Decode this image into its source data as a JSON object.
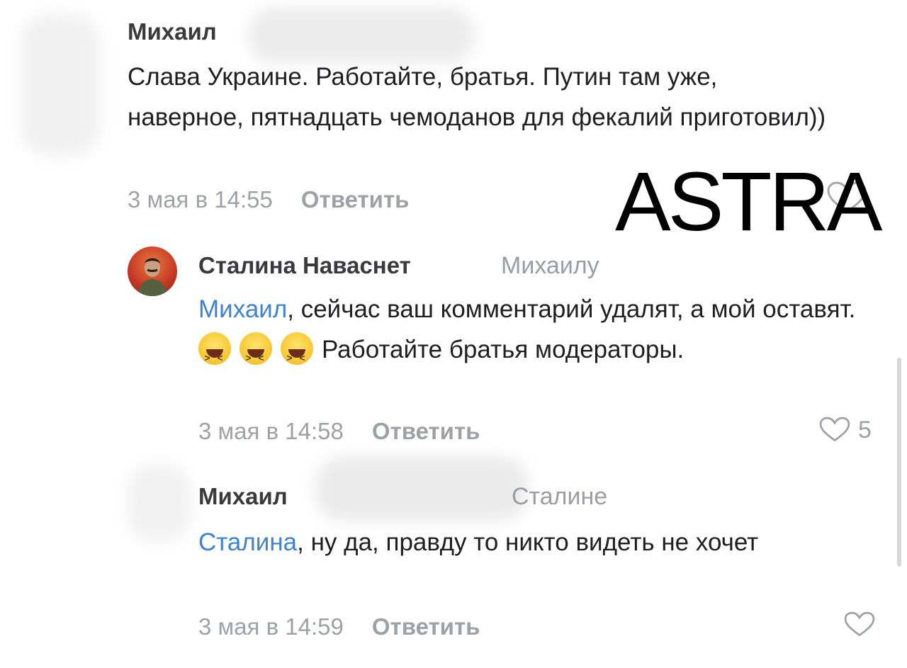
{
  "watermark": "ASTRA",
  "comments": [
    {
      "author": "Михаил",
      "text": "Слава Украине. Работайте, братья. Путин там уже, наверное, пятнадцать чемоданов для фекалий приготовил))",
      "date": "3 мая в 14:55",
      "reply_label": "Ответить"
    },
    {
      "author": "Сталина Наваснет",
      "reply_to": "Михаилу",
      "mention": "Михаил",
      "text_before_emoji": ", сейчас ваш комментарий удалят, а мой оставят.",
      "emojis": [
        "laughing-emoji",
        "laughing-emoji",
        "laughing-emoji"
      ],
      "text_after_emoji": "Работайте братья модераторы.",
      "date": "3 мая в 14:58",
      "reply_label": "Ответить",
      "likes": "5"
    },
    {
      "author": "Михаил",
      "reply_to": "Сталине",
      "mention": "Сталина",
      "text": ", ну да, правду то никто видеть не хочет",
      "date": "3 мая в 14:59",
      "reply_label": "Ответить"
    }
  ],
  "colors": {
    "mention": "#3d83cf",
    "meta": "#9ea1a6",
    "author": "#3a3a3c",
    "text": "#1f1f21"
  }
}
